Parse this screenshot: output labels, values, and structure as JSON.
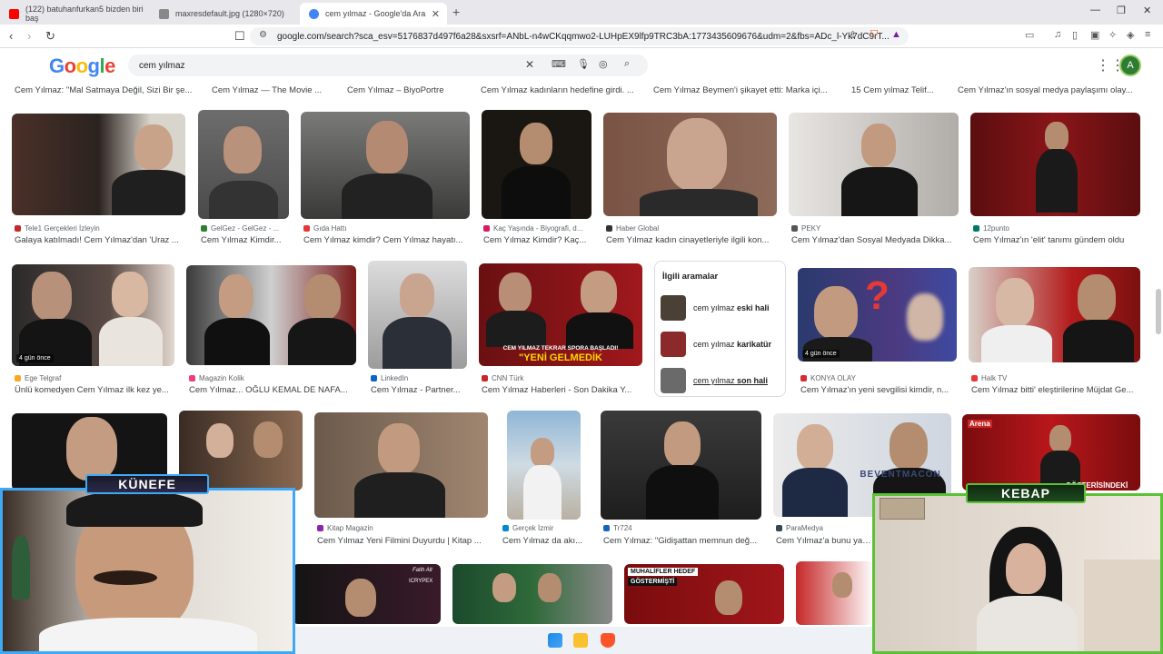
{
  "browser": {
    "tabs": [
      {
        "title": "(122) batuhanfurkan5 bizden biri baş",
        "color": "#ff0000"
      },
      {
        "title": "maxresdefault.jpg (1280×720)",
        "color": "#888888"
      },
      {
        "title": "cem yılmaz - Google'da Ara",
        "color": "#4285f4"
      }
    ],
    "url": "google.com/search?sca_esv=5176837d497f6a28&sxsrf=ANbL-n4wCKqqmwo2-LUHpEX9lfp9TRC3bA:1773435609676&udm=2&fbs=ADc_l-Yk7dC9rT..."
  },
  "google": {
    "logo": "Google",
    "query": "cem yılmaz",
    "avatar_letter": "A"
  },
  "row0_captions": [
    "Cem Yılmaz: \"Mal Satmaya Değil, Sizi Bir şe...",
    "Cem Yılmaz — The Movie ...",
    "Cem Yılmaz – BiyoPortre",
    "Cem Yılmaz kadınların hedefine girdi. ...",
    "Cem Yılmaz Beymen'i şikayet etti: Marka içi...",
    "15 Cem yılmaz Telif...",
    "Cem Yılmaz'ın sosyal medya paylaşımı olay..."
  ],
  "row1": [
    {
      "source": "Tele1 Gerçekleri İzleyin",
      "caption": "Galaya katılmadı! Cem Yılmaz'dan 'Uraz ..."
    },
    {
      "source": "GelGez - GelGez - ...",
      "caption": "Cem Yılmaz Kimdir..."
    },
    {
      "source": "Gıda Hattı",
      "caption": "Cem Yılmaz kimdir? Cem Yılmaz hayatı..."
    },
    {
      "source": "Kaç Yaşında - Biyografi, d...",
      "caption": "Cem Yılmaz Kimdir? Kaç..."
    },
    {
      "source": "Haber Global",
      "caption": "Cem Yılmaz kadın cinayetleriyle ilgili kon..."
    },
    {
      "source": "PEKY",
      "caption": "Cem Yılmaz'dan Sosyal Medyada Dikka..."
    },
    {
      "source": "12punto",
      "caption": "Cem Yılmaz'ın 'elit' tanımı gündem oldu"
    }
  ],
  "row2": [
    {
      "source": "Ege Telgraf",
      "caption": "Ünlü komedyen Cem Yılmaz ilk kez ye...",
      "badge": "4 gün önce"
    },
    {
      "source": "Magazin Kolik",
      "caption": "Cem Yılmaz... OĞLU KEMAL DE NAFA..."
    },
    {
      "source": "LinkedIn",
      "caption": "Cem Yılmaz - Partner..."
    },
    {
      "source": "CNN Türk",
      "caption": "Cem Yılmaz Haberleri - Son Dakika Y...",
      "overlay1": "CEM YILMAZ TEKRAR SPORA BAŞLADI!",
      "overlay2": "\"YENİ GELMEDİK"
    },
    {
      "source": "KONYA OLAY",
      "caption": "Cem Yılmaz'ın yeni sevgilisi kimdir, n...",
      "badge": "4 gün önce"
    },
    {
      "source": "Halk TV",
      "caption": "Cem Yılmaz bitti' eleştirilerine Müjdat Ge..."
    }
  ],
  "related": {
    "title": "İlgili aramalar",
    "items": [
      {
        "prefix": "cem yılmaz",
        "bold": "eski hali"
      },
      {
        "prefix": "cem yılmaz",
        "bold": "karikatür"
      },
      {
        "prefix": "cem yılmaz",
        "bold": "son hali"
      }
    ]
  },
  "row3": [
    {
      "source": "Kitap Magazin",
      "caption": "Cem Yılmaz Yeni Filmini Duyurdu | Kitap ..."
    },
    {
      "source": "Gerçek İzmir",
      "caption": "Cem Yılmaz da akı..."
    },
    {
      "source": "Tr724",
      "caption": "Cem Yılmaz: \"Gidişattan memnun değ..."
    },
    {
      "source": "ParaMedya",
      "caption": "Cem Yılmaz'a bunu yapa..."
    }
  ],
  "row3_overlays": {
    "bevent": "BEVENTMACON",
    "arena": "Arena",
    "gosterisindeki": "GÖSTERİSİNDEKİ"
  },
  "row4_overlays": {
    "fatih": "Fatih Alt",
    "icrypex": "ICRYPEX",
    "muhalifler1": "MUHALİFLER HEDEF",
    "muhalifler2": "GÖSTERMİŞTİ"
  },
  "overlays": {
    "left_cam_label": "KÜNEFE",
    "right_cam_label": "KEBAP"
  },
  "colors": {
    "left_frame": "#3fa9f5",
    "right_frame": "#5bc236",
    "avatar": "#2e7d32"
  }
}
